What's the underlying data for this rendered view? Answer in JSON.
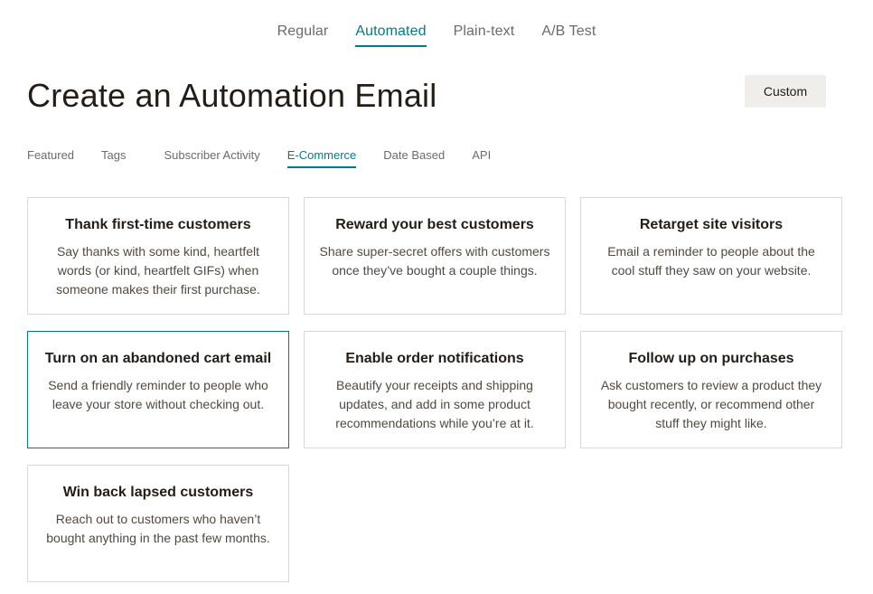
{
  "type_tabs": {
    "regular": "Regular",
    "automated": "Automated",
    "plain_text": "Plain-text",
    "ab_test": "A/B Test",
    "active": "Automated"
  },
  "page_title": "Create an Automation Email",
  "custom_button_label": "Custom",
  "category_tabs": {
    "featured": "Featured",
    "tags": "Tags",
    "subscriber_activity": "Subscriber Activity",
    "ecommerce": "E-Commerce",
    "date_based": "Date Based",
    "api": "API",
    "active": "E-Commerce"
  },
  "cards": [
    {
      "title": "Thank first-time customers",
      "description": "Say thanks with some kind, heartfelt words (or kind, heartfelt GIFs) when someone makes their first purchase."
    },
    {
      "title": "Reward your best customers",
      "description": "Share super-secret offers with customers once they’ve bought a couple things."
    },
    {
      "title": "Retarget site visitors",
      "description": "Email a reminder to people about the cool stuff they saw on your website."
    },
    {
      "title": "Turn on an abandoned cart email",
      "description": "Send a friendly reminder to people who leave your store without checking out."
    },
    {
      "title": "Enable order notifications",
      "description": "Beautify your receipts and shipping updates, and add in some product recommendations while you’re at it."
    },
    {
      "title": "Follow up on purchases",
      "description": "Ask customers to review a product they bought recently, or recommend other stuff they might like."
    },
    {
      "title": "Win back lapsed customers",
      "description": "Reach out to customers who haven’t bought anything in the past few months."
    }
  ],
  "colors": {
    "accent": "#007c89",
    "text": "#241c15",
    "button_bg": "#efeeea",
    "card_border": "#d8d8d8"
  }
}
